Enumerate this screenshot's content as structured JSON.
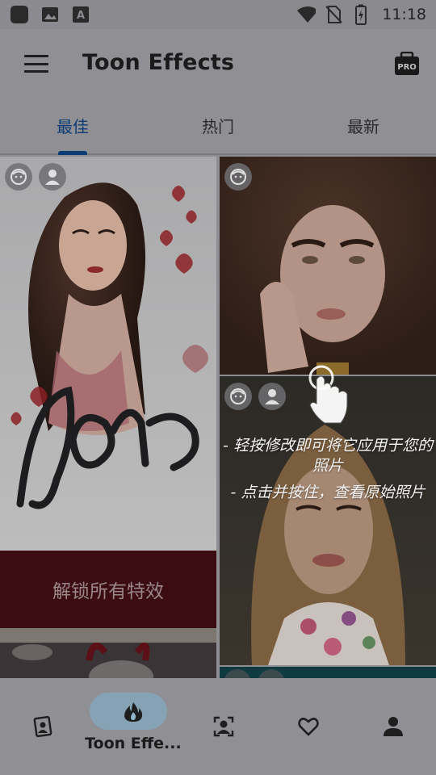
{
  "status_bar": {
    "time": "11:18",
    "icons": [
      "app-icon",
      "image-icon",
      "translate-icon",
      "wifi-icon",
      "no-sim-icon",
      "battery-charging-icon"
    ]
  },
  "app_bar": {
    "title": "Toon Effects",
    "menu_icon": "hamburger-menu-icon",
    "pro_label": "PRO"
  },
  "tabs": [
    {
      "label": "最佳",
      "active": true
    },
    {
      "label": "热门",
      "active": false
    },
    {
      "label": "最新",
      "active": false
    }
  ],
  "grid": {
    "unlock_label": "解锁所有特效",
    "hint_lines": [
      "- 轻按修改即可将它应用于您的照片",
      "- 点击并按住，查看原始照片"
    ]
  },
  "bottom_nav": [
    {
      "icon": "portrait-frame-icon",
      "label": "",
      "active": false
    },
    {
      "icon": "flame-icon",
      "label": "Toon Effe...",
      "active": true
    },
    {
      "icon": "face-scan-icon",
      "label": "",
      "active": false
    },
    {
      "icon": "heart-icon",
      "label": "",
      "active": false
    },
    {
      "icon": "person-icon",
      "label": "",
      "active": false
    }
  ],
  "colors": {
    "accent": "#0b3d74",
    "overlay": "#8f8f94",
    "unlock_bg": "#3b0c12"
  }
}
